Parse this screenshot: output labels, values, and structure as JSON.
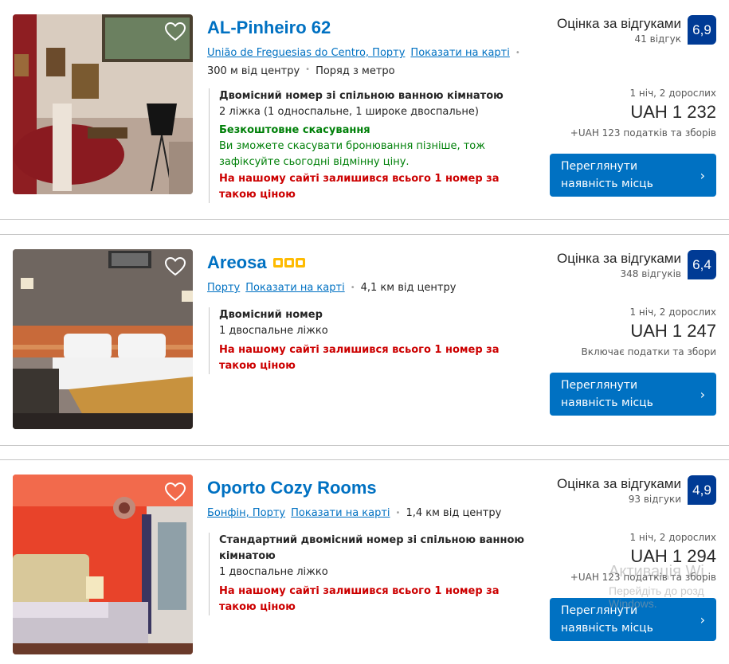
{
  "listings": [
    {
      "name": "AL-Pinheiro 62",
      "location_link": "União de Freguesias do Centro, Порту",
      "map_link": "Показати на карті",
      "distance": "300 м від центру",
      "extra": "Поряд з метро",
      "room_name": "Двомісний номер зі спільною ванною кімнатою",
      "beds": "2 ліжка (1 односпальне, 1 широке двоспальне)",
      "free_cancel": "Безкоштовне скасування",
      "free_cancel_desc": "Ви зможете скасувати бронювання пізніше, тож зафіксуйте сьогодні відмінну ціну.",
      "scarcity": "На нашому сайті залишився всього 1 номер за такою ціною",
      "review_label": "Оцінка за відгуками",
      "review_count": "41 відгук",
      "score": "6,9",
      "occupancy": "1 ніч, 2 дорослих",
      "price": "UAH 1 232",
      "taxes": "+UAH 123 податків та зборів",
      "cta": "Переглянути наявність місць",
      "stars": 0
    },
    {
      "name": "Areosa",
      "location_link": "Порту",
      "map_link": "Показати на карті",
      "distance": "4,1 км від центру",
      "room_name": "Двомісний номер",
      "beds": "1 двоспальне ліжко",
      "scarcity": "На нашому сайті залишився всього 1 номер за такою ціною",
      "review_label": "Оцінка за відгуками",
      "review_count": "348 відгуків",
      "score": "6,4",
      "occupancy": "1 ніч, 2 дорослих",
      "price": "UAH 1 247",
      "taxes": "Включає податки та збори",
      "cta": "Переглянути наявність місць",
      "stars": 3
    },
    {
      "name": "Oporto Cozy Rooms",
      "location_link": "Бонфін, Порту",
      "map_link": "Показати на карті",
      "distance": "1,4 км від центру",
      "room_name": "Стандартний двомісний номер зі спільною ванною кімнатою",
      "beds": "1 двоспальне ліжко",
      "scarcity": "На нашому сайті залишився всього 1 номер за такою ціною",
      "review_label": "Оцінка за відгуками",
      "review_count": "93 відгуки",
      "score": "4,9",
      "occupancy": "1 ніч, 2 дорослих",
      "price": "UAH 1 294",
      "taxes": "+UAH 123 податків та зборів",
      "cta": "Переглянути наявність місць",
      "stars": 0
    }
  ],
  "watermark": {
    "line1": "Активація Wi",
    "line2": "Перейдіть до розд",
    "line3": "Windows."
  },
  "colors": {
    "link": "#0071c2",
    "score_bg": "#003b95",
    "cta_bg": "#0071c2",
    "free_cancel": "#008009",
    "scarcity": "#cc0000",
    "star": "#febb02"
  },
  "icons": {
    "favorite": "heart-icon",
    "cta_arrow": "chevron-right-icon"
  }
}
